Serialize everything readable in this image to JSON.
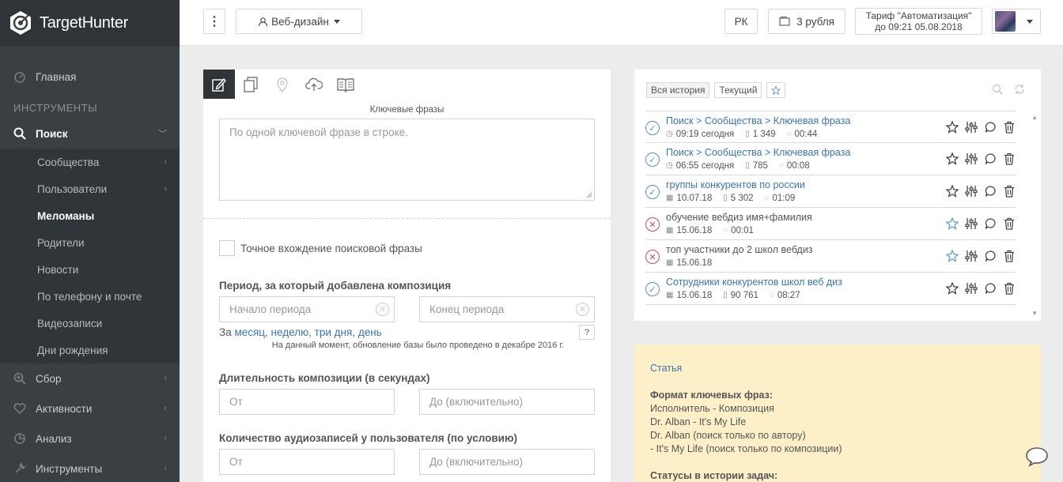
{
  "app": {
    "logo_text": "TargetHunter"
  },
  "sidebar": {
    "home": "Главная",
    "section_tools": "ИНСТРУМЕНТЫ",
    "search": "Поиск",
    "search_sub": [
      "Сообщества",
      "Пользователи",
      "Меломаны",
      "Родители",
      "Новости",
      "По телефону и почте",
      "Видеозаписи",
      "Дни рождения"
    ],
    "collect": "Сбор",
    "activity": "Активности",
    "analysis": "Анализ",
    "tools": "Инструменты"
  },
  "topbar": {
    "kebab": "⋮",
    "project": "Веб-дизайн",
    "rk": "РК",
    "balance": "3 рубля",
    "tariff_line1": "Тариф \"Автоматизация\"",
    "tariff_line2": "до 09:21 05.08.2018"
  },
  "form": {
    "keyphrases_label": "Ключевые фразы",
    "keyphrases_placeholder": "По одной ключевой фразе в строке.",
    "exact_match": "Точное вхождение поисковой фразы",
    "period_title": "Период, за который добавлена композиция",
    "period_start": "Начало периода",
    "period_end": "Конец периода",
    "quick_prefix": "За",
    "quick_month": "месяц",
    "quick_week": "неделю",
    "quick_3days": "три дня",
    "quick_day": "день",
    "help_btn": "?",
    "db_note": "На данный момент, обновление базы было проведено в декабре 2016 г.",
    "duration_title": "Длительность композиции (в секундах)",
    "from": "От",
    "to": "До (включительно)",
    "audio_count_title": "Количество аудиозаписей у пользователя (по условию)"
  },
  "history": {
    "tab_all": "Вся история",
    "tab_current": "Текущий",
    "rows": [
      {
        "title": "Поиск > Сообщества > Ключевая фраза",
        "time": "09:19 сегодня",
        "count": "1 349",
        "dur": "00:44",
        "status": "ok",
        "link": true
      },
      {
        "title": "Поиск > Сообщества > Ключевая фраза",
        "time": "06:55 сегодня",
        "count": "785",
        "dur": "00:08",
        "status": "ok",
        "link": true
      },
      {
        "title": "группы конкурентов по россии",
        "time": "10.07.18",
        "count": "5 302",
        "dur": "01:09",
        "status": "ok",
        "link": true
      },
      {
        "title": "обучение вебдиз имя+фамилия",
        "time": "15.06.18",
        "count": "",
        "dur": "00:01",
        "status": "err",
        "link": false
      },
      {
        "title": "топ участники до 2 школ вебдиз",
        "time": "15.06.18",
        "count": "",
        "dur": "",
        "status": "err",
        "link": false
      },
      {
        "title": "Сотрудники конкурентов школ веб диз",
        "time": "15.06.18",
        "count": "90 761",
        "dur": "08:27",
        "status": "ok",
        "link": true
      }
    ]
  },
  "help": {
    "article_link": "Статья",
    "format_title": "Формат ключевых фраз:",
    "lines": [
      "Исполнитель - Композиция",
      "Dr. Alban - It's My Life",
      "Dr. Alban (поиск только по автору)",
      "- It's My Life (поиск только по композиции)"
    ],
    "statuses_title": "Статусы в истории задач:"
  }
}
